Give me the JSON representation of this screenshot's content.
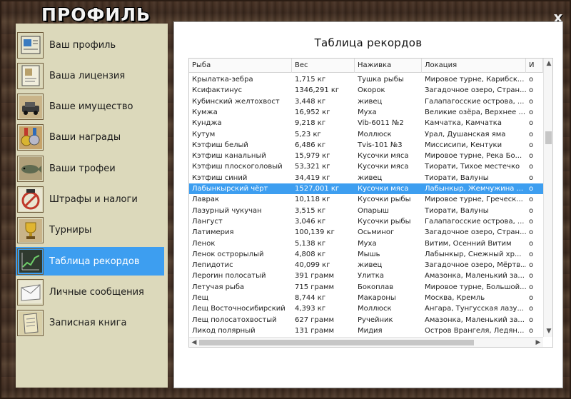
{
  "header": {
    "title": "ПРОФИЛЬ",
    "close_label": "x"
  },
  "sidebar": {
    "items": [
      {
        "label": "Ваш профиль",
        "icon": "profile-card-icon",
        "active": false
      },
      {
        "label": "Ваша лицензия",
        "icon": "license-document-icon",
        "active": false
      },
      {
        "label": "Ваше имущество",
        "icon": "car-property-icon",
        "active": false
      },
      {
        "label": "Ваши награды",
        "icon": "medals-icon",
        "active": false
      },
      {
        "label": "Ваши трофеи",
        "icon": "fish-trophy-icon",
        "active": false
      },
      {
        "label": "Штрафы и налоги",
        "icon": "fines-stamp-icon",
        "active": false
      },
      {
        "label": "Турниры",
        "icon": "tournament-cup-icon",
        "active": false
      },
      {
        "label": "Таблица рекордов",
        "icon": "records-chart-icon",
        "active": true
      },
      {
        "label": "Личные сообщения",
        "icon": "envelope-icon",
        "active": false
      },
      {
        "label": "Записная книга",
        "icon": "notebook-icon",
        "active": false
      }
    ]
  },
  "main": {
    "title": "Таблица рекордов",
    "columns": [
      "Рыба",
      "Вес",
      "Наживка",
      "Локация",
      "И"
    ],
    "rows": [
      [
        "Крылатка-зебра",
        "1,715 кг",
        "Тушка рыбы",
        "Мировое турне, Карибск...",
        "о"
      ],
      [
        "Ксифактинус",
        "1346,291 кг",
        "Окорок",
        "Загадочное озеро, Стран...",
        "о"
      ],
      [
        "Кубинский желтохвост",
        "3,448 кг",
        "живец",
        "Галапагосские острова, ...",
        "о"
      ],
      [
        "Кумжа",
        "16,952 кг",
        "Муха",
        "Великие озёра, Верхнее ...",
        "о"
      ],
      [
        "Кунджа",
        "9,218 кг",
        "Vib-6011 №2",
        "Камчатка, Камчатка",
        "о"
      ],
      [
        "Кутум",
        "5,23 кг",
        "Моллюск",
        "Урал, Душанская яма",
        "о"
      ],
      [
        "Кэтфиш белый",
        "6,486 кг",
        "Tvis-101 №3",
        "Миссисипи, Кентуки",
        "о"
      ],
      [
        "Кэтфиш канальный",
        "15,979 кг",
        "Кусочки мяса",
        "Мировое турне, Река Бо...",
        "о"
      ],
      [
        "Кэтфиш плоскоголовый",
        "53,321 кг",
        "Кусочки мяса",
        "Тиорати, Тихое местечко",
        "о"
      ],
      [
        "Кэтфиш синий",
        "34,419 кг",
        "живец",
        "Тиорати, Валуны",
        "о"
      ],
      [
        "Лабынкырский чёрт",
        "1527,001 кг",
        "Кусочки мяса",
        "Лабынкыр, Жемчужина ...",
        "о"
      ],
      [
        "Лаврак",
        "10,118 кг",
        "Кусочки рыбы",
        "Мировое турне, Греческ...",
        "о"
      ],
      [
        "Лазурный чукучан",
        "3,515 кг",
        "Опарыш",
        "Тиорати, Валуны",
        "о"
      ],
      [
        "Лангуст",
        "3,046 кг",
        "Кусочки рыбы",
        "Галапагосские острова, ...",
        "о"
      ],
      [
        "Латимерия",
        "100,139 кг",
        "Осьминог",
        "Загадочное озеро, Стран...",
        "о"
      ],
      [
        "Ленок",
        "5,138 кг",
        "Муха",
        "Витим, Осенний Витим",
        "о"
      ],
      [
        "Ленок острорылый",
        "4,808 кг",
        "Мышь",
        "Лабынкыр, Снежный хр...",
        "о"
      ],
      [
        "Лепидотис",
        "40,099 кг",
        "живец",
        "Загадочное озеро, Мёртв...",
        "о"
      ],
      [
        "Леporин полосатый",
        "391 грамм",
        "Улитка",
        "Амазонка, Маленький за...",
        "о"
      ],
      [
        "Летучая рыба",
        "715 грамм",
        "Бокоплав",
        "Мировое турне, Большой...",
        "о"
      ],
      [
        "Лещ",
        "8,744 кг",
        "Макароны",
        "Москва, Кремль",
        "о"
      ],
      [
        "Лещ Восточносибирский",
        "4,393 кг",
        "Моллюск",
        "Ангара, Тунгусская лазу...",
        "о"
      ],
      [
        "Лещ полосатохвостый",
        "627 грамм",
        "Ручейник",
        "Амазонка, Маленький за...",
        "о"
      ],
      [
        "Ликод полярный",
        "131 грамм",
        "Мидия",
        "Остров Врангеля, Ледян...",
        "о"
      ]
    ],
    "selected_row": 10
  },
  "colors": {
    "accent": "#3d9ef0",
    "sidebar_bg": "#dcd9bb",
    "wood": "#4a3426"
  }
}
